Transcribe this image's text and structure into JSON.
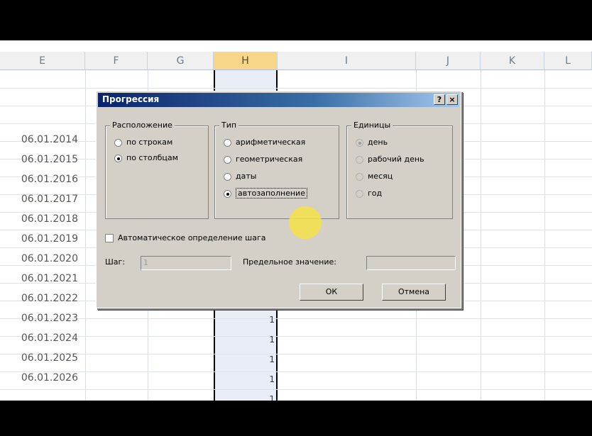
{
  "columns": [
    {
      "id": "col-e",
      "label": "E"
    },
    {
      "id": "col-f",
      "label": "F"
    },
    {
      "id": "col-g",
      "label": "G"
    },
    {
      "id": "col-h",
      "label": "H"
    },
    {
      "id": "col-i",
      "label": "I"
    },
    {
      "id": "col-j",
      "label": "J"
    },
    {
      "id": "col-k",
      "label": "K"
    },
    {
      "id": "col-l",
      "label": "L"
    }
  ],
  "dates": [
    "06.01.2014",
    "06.01.2015",
    "06.01.2016",
    "06.01.2017",
    "06.01.2018",
    "06.01.2019",
    "06.01.2020",
    "06.01.2021",
    "06.01.2022",
    "06.01.2023",
    "06.01.2024",
    "06.01.2025",
    "06.01.2026"
  ],
  "h_values": [
    "1",
    "1",
    "1",
    "1",
    "1"
  ],
  "dialog": {
    "title": "Прогрессия",
    "help_btn": "?",
    "close_btn": "×",
    "layout_group": {
      "label": "Расположение",
      "options": [
        "по строкам",
        "по столбцам"
      ],
      "selected": 1
    },
    "type_group": {
      "label": "Тип",
      "options": [
        "арифметическая",
        "геометрическая",
        "даты",
        "автозаполнение"
      ],
      "selected": 3
    },
    "units_group": {
      "label": "Единицы",
      "options": [
        "день",
        "рабочий день",
        "месяц",
        "год"
      ],
      "selected": 0
    },
    "auto_step_label": "Автоматическое определение шага",
    "step_label": "Шаг:",
    "step_value": "1",
    "limit_label": "Предельное значение:",
    "limit_value": "",
    "ok_label": "ОК",
    "cancel_label": "Отмена"
  }
}
